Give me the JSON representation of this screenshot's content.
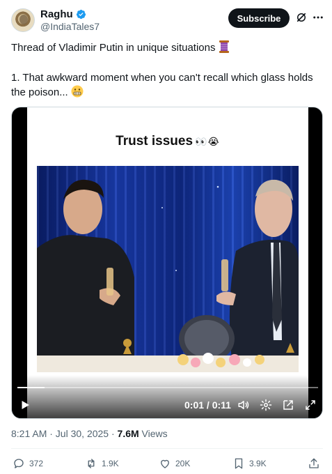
{
  "author": {
    "display_name": "Raghu",
    "handle": "@IndiaTales7",
    "verified": true
  },
  "header": {
    "subscribe_label": "Subscribe",
    "icons": [
      "grok-icon",
      "more-icon"
    ]
  },
  "tweet": {
    "line1": "Thread of Vladimir Putin in unique situations",
    "line1_emoji": "🧵",
    "line2": "1. That awkward moment when you can't recall which glass holds the poison...",
    "line2_emoji": "😬"
  },
  "video": {
    "caption": "Trust issues",
    "caption_emoji": "👀😭",
    "time_display": "0:01 / 0:11",
    "progress": 0.09,
    "controls": [
      "play-icon",
      "volume-icon",
      "settings-icon",
      "popout-icon",
      "fullscreen-icon"
    ]
  },
  "meta": {
    "timestamp": "8:21 AM · Jul 30, 2025",
    "separator": " · ",
    "views_count": "7.6M",
    "views_label": " Views"
  },
  "actions": {
    "replies": "372",
    "reposts": "1.9K",
    "likes": "20K",
    "bookmarks": "3.9K"
  },
  "colors": {
    "text": "#0f1419",
    "secondary": "#536471",
    "verified": "#1d9bf0",
    "divider": "#eff3f4"
  }
}
